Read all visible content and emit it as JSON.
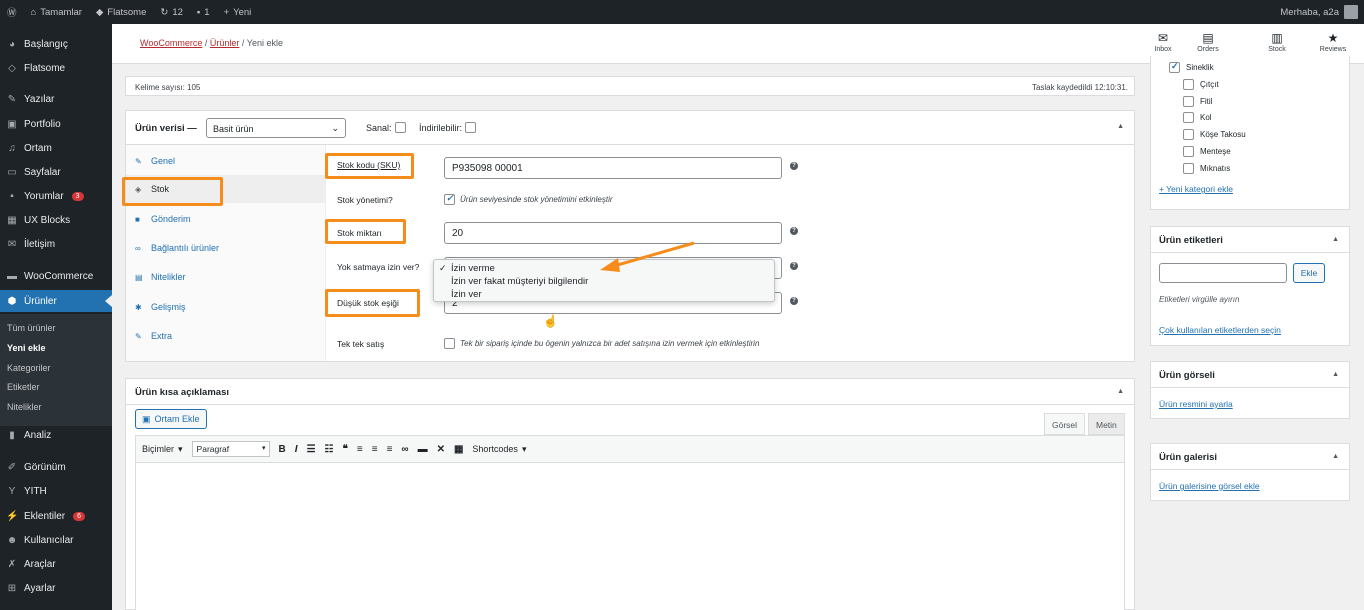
{
  "adminbar": {
    "site_name": "Tamamlar",
    "theme": "Flatsome",
    "updates": "12",
    "comments": "1",
    "new": "Yeni",
    "greeting": "Merhaba, a2a"
  },
  "sidebar": {
    "items": [
      {
        "label": "Başlangıç",
        "icon": "dashboard-icon"
      },
      {
        "label": "Flatsome",
        "icon": "flatsome-icon"
      },
      {
        "label": "Yazılar",
        "icon": "pin-icon"
      },
      {
        "label": "Portfolio",
        "icon": "portfolio-icon"
      },
      {
        "label": "Ortam",
        "icon": "media-icon"
      },
      {
        "label": "Sayfalar",
        "icon": "page-icon"
      },
      {
        "label": "Yorumlar",
        "icon": "comment-icon",
        "badge": "3"
      },
      {
        "label": "UX Blocks",
        "icon": "blocks-icon"
      },
      {
        "label": "İletişim",
        "icon": "mail-icon"
      },
      {
        "label": "WooCommerce",
        "icon": "woo-icon"
      },
      {
        "label": "Ürünler",
        "icon": "product-icon"
      },
      {
        "label": "Analiz",
        "icon": "chart-icon"
      },
      {
        "label": "Görünüm",
        "icon": "brush-icon"
      },
      {
        "label": "YITH",
        "icon": "yith-icon"
      },
      {
        "label": "Eklentiler",
        "icon": "plugin-icon",
        "badge": "6"
      },
      {
        "label": "Kullanıcılar",
        "icon": "user-icon"
      },
      {
        "label": "Araçlar",
        "icon": "wrench-icon"
      },
      {
        "label": "Ayarlar",
        "icon": "settings-icon"
      }
    ],
    "submenu": [
      "Tüm ürünler",
      "Yeni ekle",
      "Kategoriler",
      "Etiketler",
      "Nitelikler"
    ]
  },
  "header": {
    "breadcrumb": [
      "WooCommerce",
      "Ürünler",
      "Yeni ekle"
    ],
    "buttons": [
      {
        "label": "Inbox",
        "icon": "inbox-icon"
      },
      {
        "label": "Orders",
        "icon": "orders-icon"
      },
      {
        "label": "Stock",
        "icon": "stock-icon"
      },
      {
        "label": "Reviews",
        "icon": "star-icon"
      }
    ]
  },
  "wordcount": {
    "left": "Kelime sayısı: 105",
    "right": "Taslak kaydedildi 12:10:31."
  },
  "product_data": {
    "title": "Ürün verisi —",
    "type": "Basit ürün",
    "virtual_label": "Sanal:",
    "downloadable_label": "İndirilebilir:",
    "tabs": [
      {
        "label": "Genel",
        "icon": "wrench-icon"
      },
      {
        "label": "Stok",
        "icon": "tag-icon"
      },
      {
        "label": "Gönderim",
        "icon": "truck-icon"
      },
      {
        "label": "Bağlantılı ürünler",
        "icon": "link-icon"
      },
      {
        "label": "Nitelikler",
        "icon": "list-icon"
      },
      {
        "label": "Gelişmiş",
        "icon": "gear-icon"
      },
      {
        "label": "Extra",
        "icon": "wrench-icon"
      }
    ],
    "sku_label": "Stok kodu (SKU)",
    "sku_value": "P935098 00001",
    "manage_label": "Stok yönetimi?",
    "manage_text": "Ürün seviyesinde stok yönetimini etkinleştir",
    "qty_label": "Stok miktarı",
    "qty_value": "20",
    "backorder_label": "Yok satmaya izin ver?",
    "backorder_options": [
      "İzin verme",
      "İzin ver fakat müşteriyi bilgilendir",
      "İzin ver"
    ],
    "backorder_selected": "İzin verme",
    "low_stock_label": "Düşük stok eşiği",
    "low_stock_value": "2",
    "sold_individually_label": "Tek tek satış",
    "sold_individually_text": "Tek bir sipariş içinde bu ögenin yalnızca bir adet satışına izin vermek için etkinleştirin"
  },
  "short_description": {
    "title": "Ürün kısa açıklaması",
    "add_media": "Ortam Ekle",
    "tab_visual": "Görsel",
    "tab_text": "Metin",
    "formats": "Biçimler",
    "paragraph": "Paragraf",
    "shortcodes": "Shortcodes"
  },
  "categories": {
    "items": [
      {
        "label": "Sineklik",
        "checked": true
      },
      {
        "label": "Çıtçıt",
        "checked": false
      },
      {
        "label": "Fitil",
        "checked": false
      },
      {
        "label": "Kol",
        "checked": false
      },
      {
        "label": "Köşe Takosu",
        "checked": false
      },
      {
        "label": "Menteşe",
        "checked": false
      },
      {
        "label": "Mıknatıs",
        "checked": false
      }
    ],
    "add_link": "+ Yeni kategori ekle"
  },
  "tags": {
    "title": "Ürün etiketleri",
    "add_button": "Ekle",
    "hint": "Etiketleri virgülle ayırın",
    "popular_link": "Çok kullanılan etiketlerden seçin"
  },
  "product_image": {
    "title": "Ürün görseli",
    "link": "Ürün resmini ayarla"
  },
  "gallery": {
    "title": "Ürün galerisi",
    "link": "Ürün galerisine görsel ekle"
  },
  "colors": {
    "admin_dark": "#1d2327",
    "accent": "#2271b1",
    "highlight_orange": "#f58c1b"
  }
}
